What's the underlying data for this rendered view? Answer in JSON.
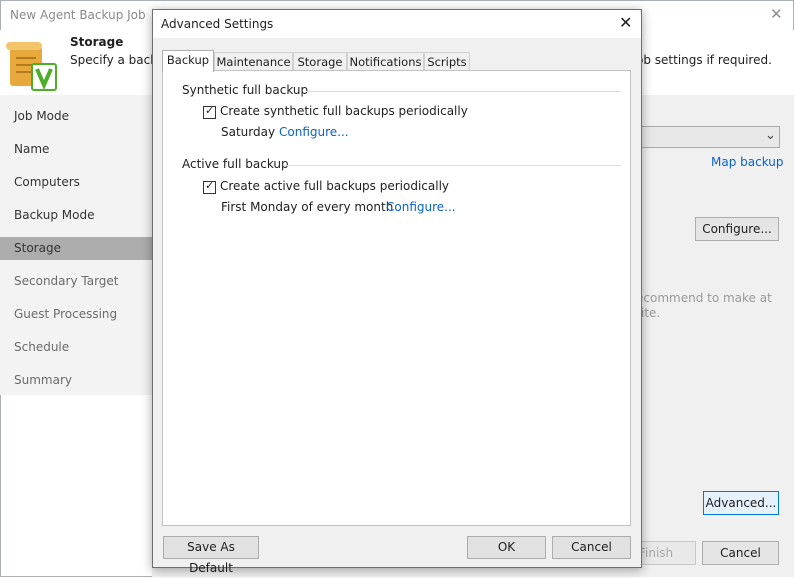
{
  "wizard": {
    "title": "New Agent Backup Job",
    "header_title": "Storage",
    "header_desc": "Specify a backu",
    "header_desc_right": "ob settings if required.",
    "steps": [
      "Job Mode",
      "Name",
      "Computers",
      "Backup Mode",
      "Storage",
      "Secondary Target",
      "Guest Processing",
      "Schedule",
      "Summary"
    ],
    "selected_step": "Storage",
    "map_backup": "Map backup",
    "configure_button": "Configure...",
    "hint_line1": "ecommend to make at",
    "hint_line2": "ite.",
    "advanced_button": "Advanced...",
    "finish_button": "Finish",
    "cancel_button": "Cancel"
  },
  "dialog": {
    "title": "Advanced Settings",
    "tabs": [
      "Backup",
      "Maintenance",
      "Storage",
      "Notifications",
      "Scripts"
    ],
    "active_tab": "Backup",
    "synthetic": {
      "group": "Synthetic full backup",
      "checkbox_label": "Create synthetic full backups periodically",
      "checked": true,
      "schedule": "Saturday",
      "configure_link": "Configure..."
    },
    "active_full": {
      "group": "Active full backup",
      "checkbox_label": "Create active full backups periodically",
      "checked": true,
      "schedule": "First Monday of every month",
      "configure_link": "Configure..."
    },
    "save_default_button": "Save As Default",
    "ok_button": "OK",
    "cancel_button": "Cancel"
  },
  "colors": {
    "link": "#0a63c9",
    "selected_step_bg": "#adadad",
    "accent_border": "#0078d7",
    "logo_green": "#4caf2a",
    "scroll_gold": "#e8a93c"
  },
  "icons": {
    "wizard_logo": "veeam-scroll-icon",
    "close": "close-icon",
    "dropdown": "chevron-down-icon",
    "check": "checkmark-icon"
  }
}
